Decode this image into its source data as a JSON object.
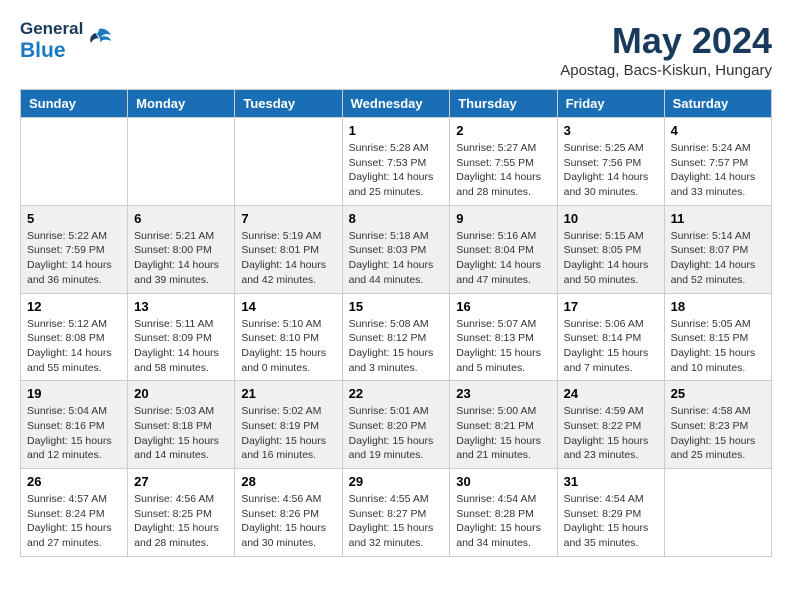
{
  "header": {
    "logo_general": "General",
    "logo_blue": "Blue",
    "month": "May 2024",
    "location": "Apostag, Bacs-Kiskun, Hungary"
  },
  "weekdays": [
    "Sunday",
    "Monday",
    "Tuesday",
    "Wednesday",
    "Thursday",
    "Friday",
    "Saturday"
  ],
  "weeks": [
    [
      {
        "day": "",
        "info": ""
      },
      {
        "day": "",
        "info": ""
      },
      {
        "day": "",
        "info": ""
      },
      {
        "day": "1",
        "info": "Sunrise: 5:28 AM\nSunset: 7:53 PM\nDaylight: 14 hours\nand 25 minutes."
      },
      {
        "day": "2",
        "info": "Sunrise: 5:27 AM\nSunset: 7:55 PM\nDaylight: 14 hours\nand 28 minutes."
      },
      {
        "day": "3",
        "info": "Sunrise: 5:25 AM\nSunset: 7:56 PM\nDaylight: 14 hours\nand 30 minutes."
      },
      {
        "day": "4",
        "info": "Sunrise: 5:24 AM\nSunset: 7:57 PM\nDaylight: 14 hours\nand 33 minutes."
      }
    ],
    [
      {
        "day": "5",
        "info": "Sunrise: 5:22 AM\nSunset: 7:59 PM\nDaylight: 14 hours\nand 36 minutes."
      },
      {
        "day": "6",
        "info": "Sunrise: 5:21 AM\nSunset: 8:00 PM\nDaylight: 14 hours\nand 39 minutes."
      },
      {
        "day": "7",
        "info": "Sunrise: 5:19 AM\nSunset: 8:01 PM\nDaylight: 14 hours\nand 42 minutes."
      },
      {
        "day": "8",
        "info": "Sunrise: 5:18 AM\nSunset: 8:03 PM\nDaylight: 14 hours\nand 44 minutes."
      },
      {
        "day": "9",
        "info": "Sunrise: 5:16 AM\nSunset: 8:04 PM\nDaylight: 14 hours\nand 47 minutes."
      },
      {
        "day": "10",
        "info": "Sunrise: 5:15 AM\nSunset: 8:05 PM\nDaylight: 14 hours\nand 50 minutes."
      },
      {
        "day": "11",
        "info": "Sunrise: 5:14 AM\nSunset: 8:07 PM\nDaylight: 14 hours\nand 52 minutes."
      }
    ],
    [
      {
        "day": "12",
        "info": "Sunrise: 5:12 AM\nSunset: 8:08 PM\nDaylight: 14 hours\nand 55 minutes."
      },
      {
        "day": "13",
        "info": "Sunrise: 5:11 AM\nSunset: 8:09 PM\nDaylight: 14 hours\nand 58 minutes."
      },
      {
        "day": "14",
        "info": "Sunrise: 5:10 AM\nSunset: 8:10 PM\nDaylight: 15 hours\nand 0 minutes."
      },
      {
        "day": "15",
        "info": "Sunrise: 5:08 AM\nSunset: 8:12 PM\nDaylight: 15 hours\nand 3 minutes."
      },
      {
        "day": "16",
        "info": "Sunrise: 5:07 AM\nSunset: 8:13 PM\nDaylight: 15 hours\nand 5 minutes."
      },
      {
        "day": "17",
        "info": "Sunrise: 5:06 AM\nSunset: 8:14 PM\nDaylight: 15 hours\nand 7 minutes."
      },
      {
        "day": "18",
        "info": "Sunrise: 5:05 AM\nSunset: 8:15 PM\nDaylight: 15 hours\nand 10 minutes."
      }
    ],
    [
      {
        "day": "19",
        "info": "Sunrise: 5:04 AM\nSunset: 8:16 PM\nDaylight: 15 hours\nand 12 minutes."
      },
      {
        "day": "20",
        "info": "Sunrise: 5:03 AM\nSunset: 8:18 PM\nDaylight: 15 hours\nand 14 minutes."
      },
      {
        "day": "21",
        "info": "Sunrise: 5:02 AM\nSunset: 8:19 PM\nDaylight: 15 hours\nand 16 minutes."
      },
      {
        "day": "22",
        "info": "Sunrise: 5:01 AM\nSunset: 8:20 PM\nDaylight: 15 hours\nand 19 minutes."
      },
      {
        "day": "23",
        "info": "Sunrise: 5:00 AM\nSunset: 8:21 PM\nDaylight: 15 hours\nand 21 minutes."
      },
      {
        "day": "24",
        "info": "Sunrise: 4:59 AM\nSunset: 8:22 PM\nDaylight: 15 hours\nand 23 minutes."
      },
      {
        "day": "25",
        "info": "Sunrise: 4:58 AM\nSunset: 8:23 PM\nDaylight: 15 hours\nand 25 minutes."
      }
    ],
    [
      {
        "day": "26",
        "info": "Sunrise: 4:57 AM\nSunset: 8:24 PM\nDaylight: 15 hours\nand 27 minutes."
      },
      {
        "day": "27",
        "info": "Sunrise: 4:56 AM\nSunset: 8:25 PM\nDaylight: 15 hours\nand 28 minutes."
      },
      {
        "day": "28",
        "info": "Sunrise: 4:56 AM\nSunset: 8:26 PM\nDaylight: 15 hours\nand 30 minutes."
      },
      {
        "day": "29",
        "info": "Sunrise: 4:55 AM\nSunset: 8:27 PM\nDaylight: 15 hours\nand 32 minutes."
      },
      {
        "day": "30",
        "info": "Sunrise: 4:54 AM\nSunset: 8:28 PM\nDaylight: 15 hours\nand 34 minutes."
      },
      {
        "day": "31",
        "info": "Sunrise: 4:54 AM\nSunset: 8:29 PM\nDaylight: 15 hours\nand 35 minutes."
      },
      {
        "day": "",
        "info": ""
      }
    ]
  ]
}
